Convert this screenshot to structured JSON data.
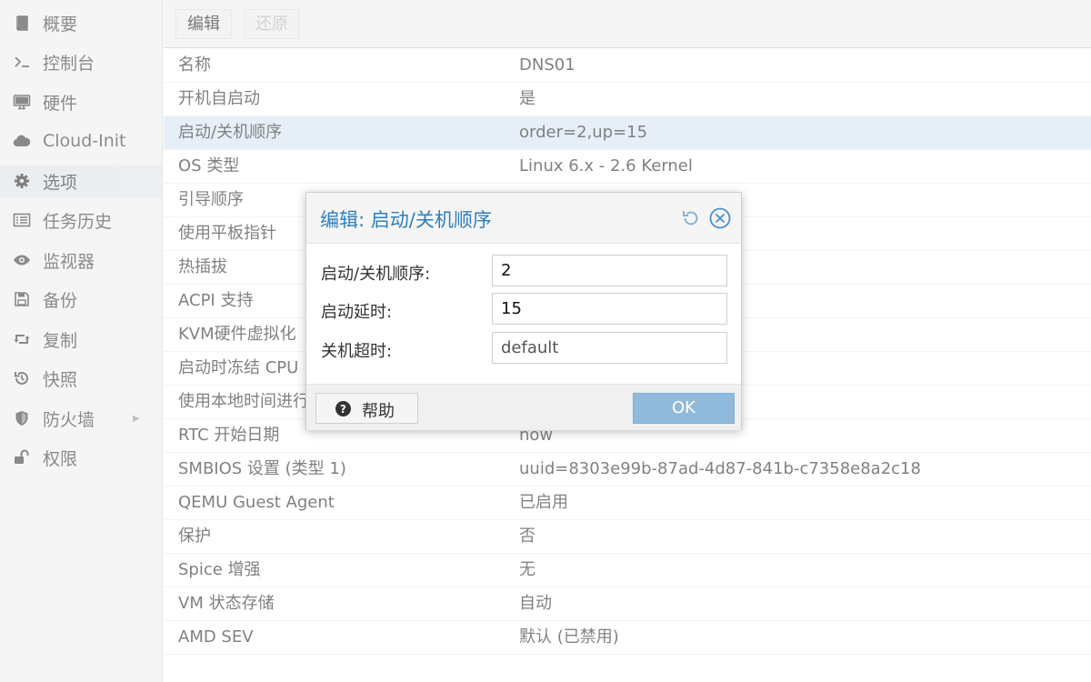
{
  "sidebar": {
    "items": [
      {
        "label": "概要",
        "icon": "book-icon"
      },
      {
        "label": "控制台",
        "icon": "terminal-icon"
      },
      {
        "label": "硬件",
        "icon": "desktop-icon"
      },
      {
        "label": "Cloud-Init",
        "icon": "cloud-icon"
      },
      {
        "label": "选项",
        "icon": "gear-icon",
        "active": true
      },
      {
        "label": "任务历史",
        "icon": "list-icon"
      },
      {
        "label": "监视器",
        "icon": "eye-icon"
      },
      {
        "label": "备份",
        "icon": "floppy-icon"
      },
      {
        "label": "复制",
        "icon": "retweet-icon"
      },
      {
        "label": "快照",
        "icon": "history-icon"
      },
      {
        "label": "防火墙",
        "icon": "shield-icon"
      },
      {
        "label": "权限",
        "icon": "unlock-icon"
      }
    ]
  },
  "toolbar": {
    "edit_label": "编辑",
    "revert_label": "还原"
  },
  "options": {
    "rows": [
      {
        "key": "名称",
        "value": "DNS01"
      },
      {
        "key": "开机自启动",
        "value": "是"
      },
      {
        "key": "启动/关机顺序",
        "value": "order=2,up=15"
      },
      {
        "key": "OS 类型",
        "value": "Linux 6.x - 2.6 Kernel"
      },
      {
        "key": "引导顺序",
        "value": ""
      },
      {
        "key": "使用平板指针",
        "value": ""
      },
      {
        "key": "热插拔",
        "value": ""
      },
      {
        "key": "ACPI 支持",
        "value": ""
      },
      {
        "key": "KVM硬件虚拟化",
        "value": ""
      },
      {
        "key": "启动时冻结 CPU",
        "value": ""
      },
      {
        "key": "使用本地时间进行",
        "value": ""
      },
      {
        "key": "RTC 开始日期",
        "value": "now"
      },
      {
        "key": "SMBIOS 设置 (类型 1)",
        "value": "uuid=8303e99b-87ad-4d87-841b-c7358e8a2c18"
      },
      {
        "key": "QEMU Guest Agent",
        "value": "已启用"
      },
      {
        "key": "保护",
        "value": "否"
      },
      {
        "key": "Spice 增强",
        "value": "无"
      },
      {
        "key": "VM 状态存储",
        "value": "自动"
      },
      {
        "key": "AMD SEV",
        "value": "默认 (已禁用)"
      }
    ]
  },
  "dialog": {
    "title": "编辑: 启动/关机顺序",
    "fields": {
      "order": {
        "label": "启动/关机顺序:",
        "value": "2"
      },
      "startup_delay": {
        "label": "启动延时:",
        "value": "15"
      },
      "shutdown_timeout": {
        "label": "关机超时:",
        "placeholder": "default"
      }
    },
    "help_label": "帮助",
    "ok_label": "OK"
  },
  "colors": {
    "accent": "#2f7fc0",
    "ok_button": "#8fbadc",
    "selected_row": "#d8e6f5"
  }
}
